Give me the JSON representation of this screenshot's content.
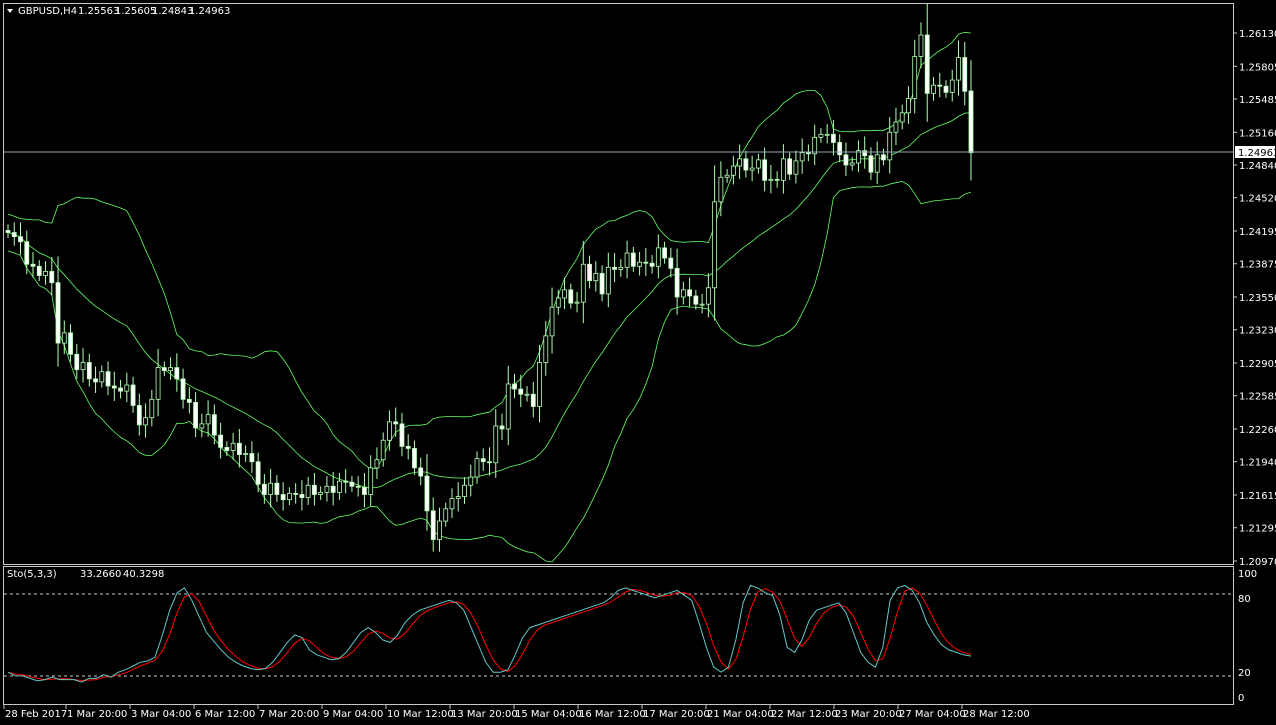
{
  "main_header": {
    "symbol": "GBPUSD,H4",
    "open": "1.25563",
    "high": "1.25605",
    "low": "1.24843",
    "close": "1.24963"
  },
  "osc_header": {
    "name": "Sto(5,3,3)",
    "main": "33.2660",
    "signal": "40.3298"
  },
  "current_price": "1.24963",
  "colors": {
    "background": "#000000",
    "grid": "#ffffff",
    "bull_candle": "#000000",
    "bear_candle": "#ffffff",
    "candle_outline": "#b4ffb4",
    "bands": "#64ff64",
    "stoch_main": "#64c8c8",
    "stoch_signal": "#ff0000",
    "price_line": "#8fa6b6"
  },
  "chart_data": [
    {
      "type": "candlestick",
      "title": "GBPUSD,H4",
      "indicator": "Bollinger Bands",
      "ylim": [
        1.2097,
        1.263
      ],
      "y_ticks": [
        "1.26130",
        "1.25805",
        "1.25485",
        "1.25160",
        "1.24840",
        "1.24520",
        "1.24195",
        "1.23875",
        "1.23550",
        "1.23230",
        "1.22905",
        "1.22585",
        "1.22260",
        "1.21940",
        "1.21615",
        "1.21295",
        "1.20970"
      ],
      "x_ticks": [
        "28 Feb 2017",
        "1 Mar 20:00",
        "3 Mar 04:00",
        "6 Mar 12:00",
        "7 Mar 20:00",
        "9 Mar 04:00",
        "10 Mar 12:00",
        "13 Mar 20:00",
        "15 Mar 04:00",
        "16 Mar 12:00",
        "17 Mar 20:00",
        "21 Mar 04:00",
        "22 Mar 12:00",
        "23 Mar 20:00",
        "27 Mar 04:00",
        "28 Mar 12:00"
      ],
      "close_approx": [
        1.2418,
        1.2414,
        1.2409,
        1.2387,
        1.2385,
        1.2376,
        1.238,
        1.2369,
        1.231,
        1.232,
        1.2299,
        1.2284,
        1.2291,
        1.2275,
        1.2272,
        1.2282,
        1.2268,
        1.2266,
        1.2263,
        1.2269,
        1.2249,
        1.223,
        1.2237,
        1.2255,
        1.2286,
        1.2283,
        1.2286,
        1.2275,
        1.2255,
        1.2252,
        1.2227,
        1.2231,
        1.224,
        1.222,
        1.2208,
        1.2205,
        1.2212,
        1.2201,
        1.2202,
        1.2194,
        1.2172,
        1.2162,
        1.2173,
        1.2162,
        1.2157,
        1.2163,
        1.2162,
        1.2159,
        1.2171,
        1.2162,
        1.2164,
        1.217,
        1.2164,
        1.2175,
        1.2174,
        1.217,
        1.2169,
        1.2162,
        1.2188,
        1.2196,
        1.2215,
        1.2233,
        1.2231,
        1.2209,
        1.2207,
        1.2188,
        1.218,
        1.2146,
        1.2118,
        1.2136,
        1.2148,
        1.2158,
        1.216,
        1.2171,
        1.2179,
        1.2197,
        1.2194,
        1.2193,
        1.2229,
        1.2226,
        1.227,
        1.2265,
        1.226,
        1.226,
        1.2248,
        1.2291,
        1.2317,
        1.2345,
        1.2354,
        1.2362,
        1.2349,
        1.235,
        1.2387,
        1.2371,
        1.2378,
        1.2358,
        1.2384,
        1.2382,
        1.2384,
        1.2398,
        1.2385,
        1.2389,
        1.2388,
        1.2385,
        1.2403,
        1.2393,
        1.2383,
        1.2355,
        1.2362,
        1.2356,
        1.2348,
        1.2348,
        1.2364,
        1.2448,
        1.2472,
        1.2474,
        1.2483,
        1.249,
        1.2479,
        1.2481,
        1.2489,
        1.2469,
        1.247,
        1.2469,
        1.249,
        1.2475,
        1.2488,
        1.2496,
        1.2495,
        1.2511,
        1.2514,
        1.2514,
        1.2506,
        1.2494,
        1.2484,
        1.2486,
        1.2498,
        1.2493,
        1.2477,
        1.2494,
        1.2489,
        1.2516,
        1.2526,
        1.2535,
        1.2549,
        1.259,
        1.2611,
        1.2554,
        1.2562,
        1.2561,
        1.2555,
        1.2567,
        1.2589,
        1.2556,
        1.2496
      ],
      "stoch_main_approx": [
        20,
        17,
        17,
        15,
        13,
        14,
        16,
        14,
        14,
        14,
        12,
        15,
        15,
        18,
        16,
        20,
        22,
        25,
        28,
        29,
        32,
        50,
        70,
        84,
        88,
        78,
        65,
        52,
        45,
        38,
        32,
        28,
        25,
        23,
        22,
        23,
        28,
        36,
        44,
        50,
        48,
        38,
        34,
        32,
        30,
        31,
        36,
        44,
        52,
        56,
        52,
        46,
        44,
        50,
        60,
        66,
        70,
        72,
        74,
        76,
        78,
        76,
        70,
        56,
        42,
        28,
        20,
        20,
        22,
        34,
        48,
        56,
        58,
        60,
        62,
        64,
        66,
        68,
        70,
        72,
        74,
        76,
        80,
        86,
        88,
        86,
        84,
        82,
        80,
        82,
        84,
        86,
        82,
        78,
        60,
        40,
        24,
        20,
        24,
        46,
        76,
        90,
        88,
        84,
        82,
        66,
        40,
        36,
        46,
        62,
        70,
        72,
        74,
        76,
        68,
        52,
        36,
        28,
        24,
        40,
        78,
        88,
        90,
        86,
        76,
        60,
        50,
        42,
        38,
        36,
        34,
        33
      ]
    },
    {
      "type": "line",
      "title": "Sto(5,3,3)",
      "ylim": [
        0,
        100
      ],
      "y_ticks": [
        "100",
        "80",
        "20",
        "0"
      ],
      "levels": [
        80,
        20
      ]
    }
  ]
}
